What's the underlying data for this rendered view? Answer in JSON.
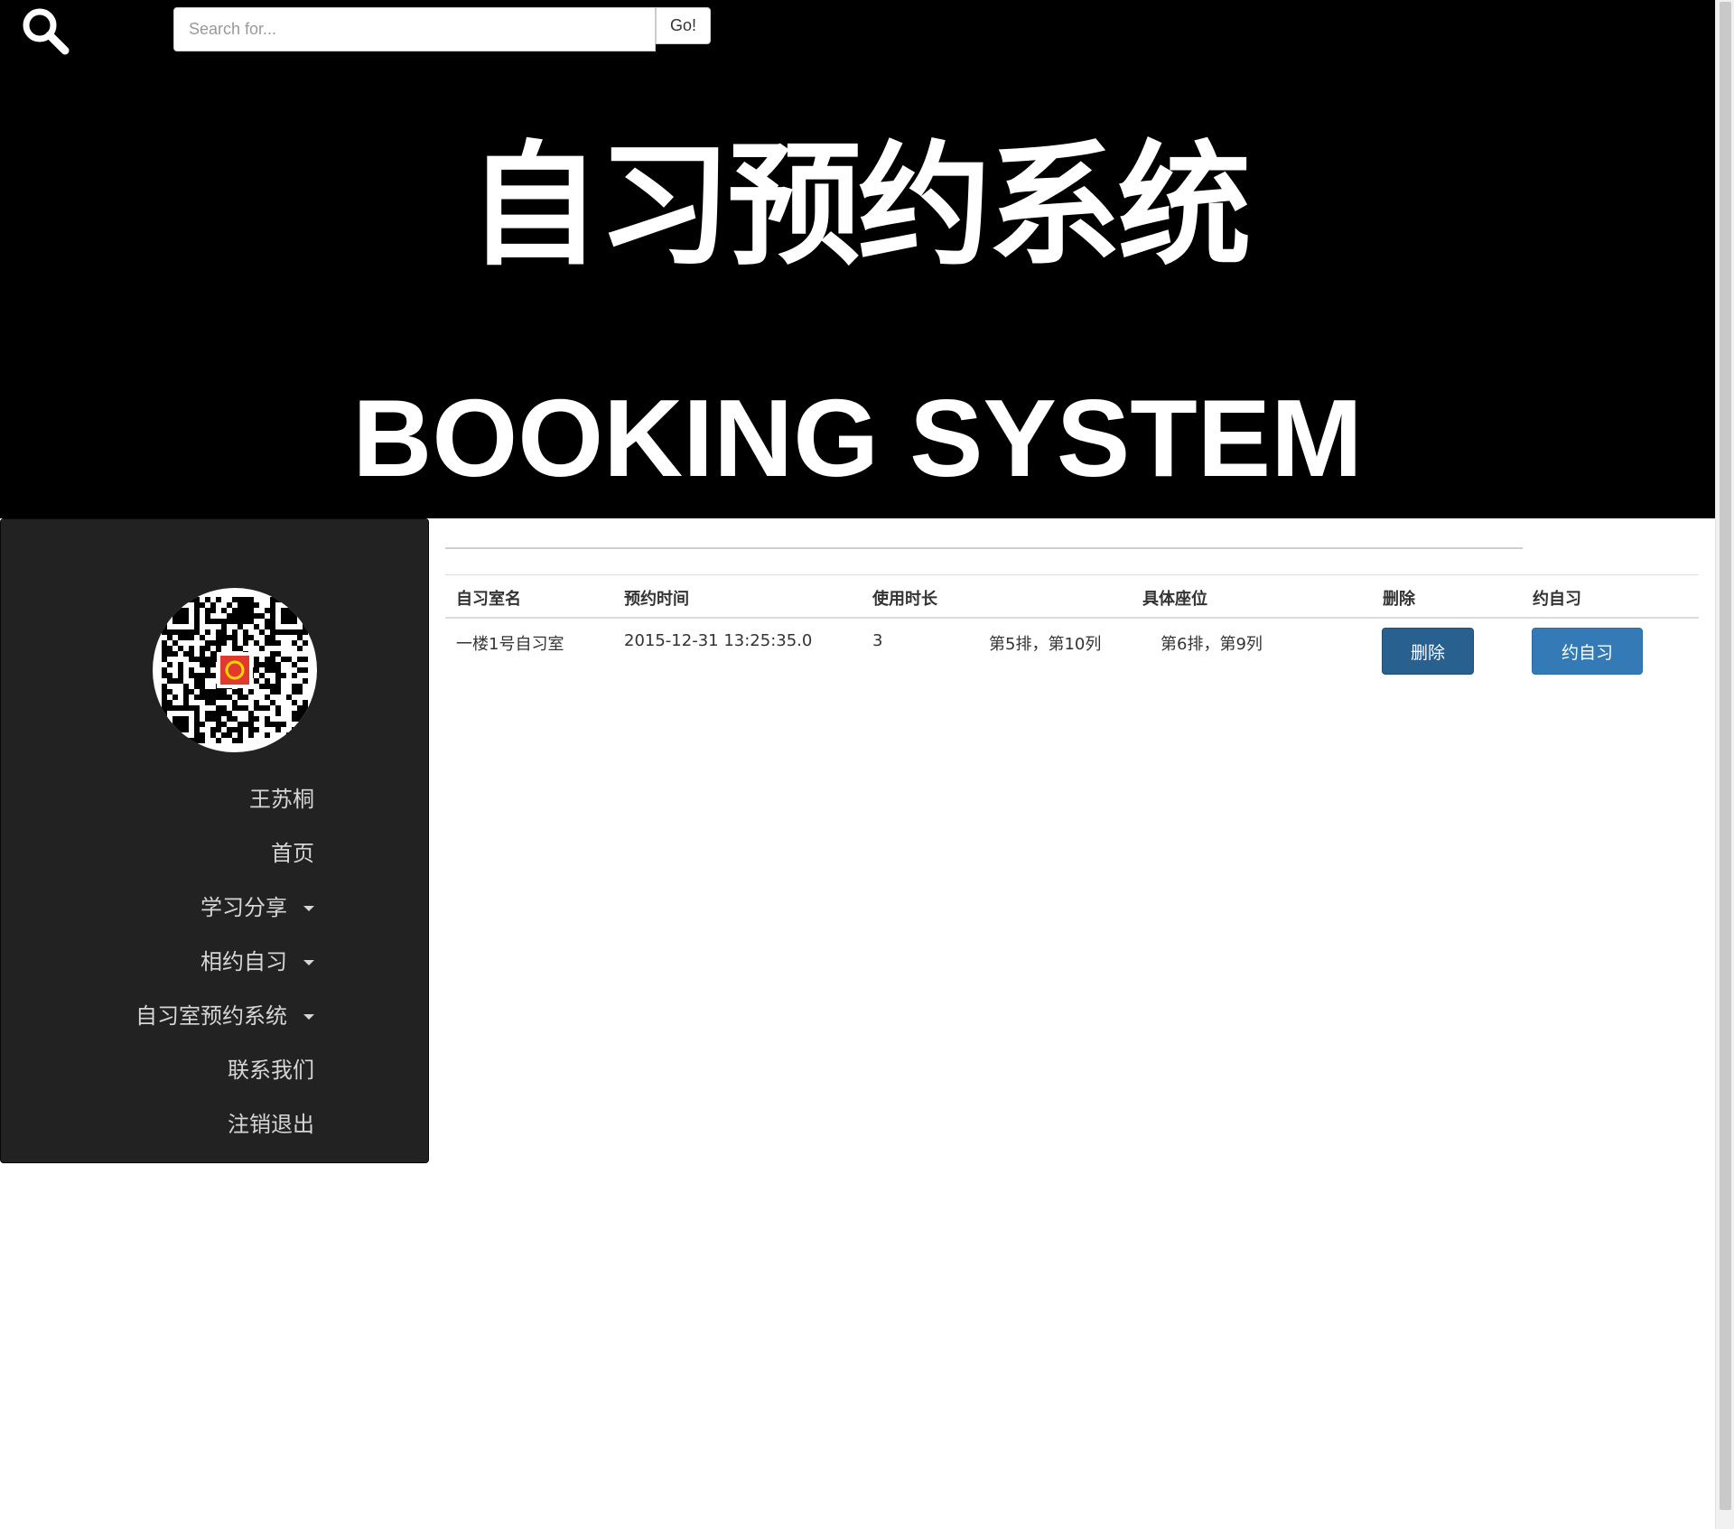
{
  "header": {
    "search_placeholder": "Search for...",
    "go_label": "Go!",
    "title_cn": "自习预约系统",
    "title_en": "BOOKING SYSTEM",
    "search_icon": "search-icon"
  },
  "sidebar": {
    "avatar_icon": "qr-code-avatar",
    "username": "王苏桐",
    "items": [
      {
        "label": "首页",
        "dropdown": false
      },
      {
        "label": "学习分享",
        "dropdown": true
      },
      {
        "label": "相约自习",
        "dropdown": true
      },
      {
        "label": "自习室预约系统",
        "dropdown": true
      },
      {
        "label": "联系我们",
        "dropdown": false
      },
      {
        "label": "注销退出",
        "dropdown": false
      }
    ]
  },
  "table": {
    "headers": [
      "自习室名",
      "预约时间",
      "使用时长",
      "具体座位",
      "删除",
      "约自习"
    ],
    "rows": [
      {
        "room": "一楼1号自习室",
        "time": "2015-12-31 13:25:35.0",
        "duration": "3",
        "seat_a": "第5排，第10列",
        "seat_b": "第6排，第9列",
        "delete_label": "删除",
        "book_label": "约自习"
      }
    ]
  },
  "colors": {
    "header_bg": "#000000",
    "sidebar_bg": "#222222",
    "btn_delete": "#286090",
    "btn_primary": "#337ab7"
  }
}
